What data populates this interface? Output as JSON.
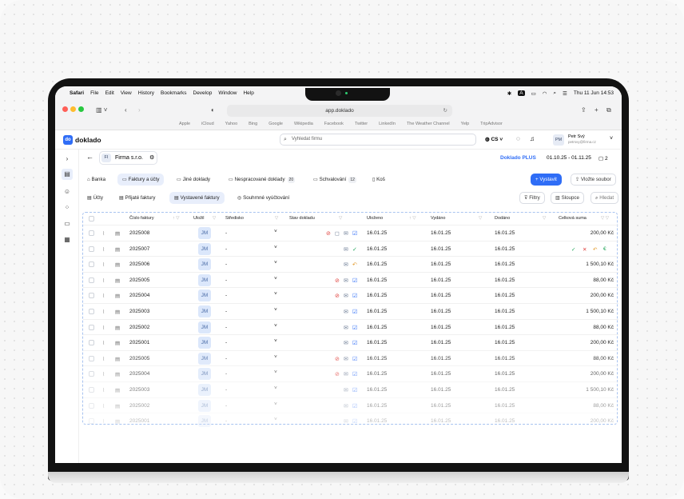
{
  "menubar": {
    "apple": "",
    "app": "Safari",
    "items": [
      "File",
      "Edit",
      "View",
      "History",
      "Bookmarks",
      "Develop",
      "Window",
      "Help"
    ],
    "lang_icon": "A",
    "datetime": "Thu 11 Jun 14:53"
  },
  "safari": {
    "url": "app.doklado",
    "favorites": [
      "Apple",
      "iCloud",
      "Yahoo",
      "Bing",
      "Google",
      "Wikipedia",
      "Facebook",
      "Twitter",
      "LinkedIn",
      "The Weather Channel",
      "Yelp",
      "TripAdvisor"
    ]
  },
  "app": {
    "logo_mark": "do",
    "logo_text": "doklado",
    "search_placeholder": "Vyhledat firmu",
    "lang": "CS",
    "user_initials": "PM",
    "user_name": "Petr Svý",
    "user_email": "petrsvy@firma.cz"
  },
  "company": {
    "initials": "FI",
    "name": "Firma s.r.o."
  },
  "plan": {
    "name": "Doklado PLUS",
    "period": "01.10.25 - 01.11.25",
    "docs": "2"
  },
  "tabs": [
    {
      "label": "Banka"
    },
    {
      "label": "Faktury a účty"
    },
    {
      "label": "Jiné doklady"
    },
    {
      "label": "Nespracované doklady",
      "badge": "20"
    },
    {
      "label": "Schvalování",
      "badge": "12"
    },
    {
      "label": "Koš"
    }
  ],
  "actions": {
    "issue": "Vystavit",
    "upload": "Vložte soubor",
    "filters": "Filtry",
    "columns": "Sloupce",
    "search_placeholder": "Hledat"
  },
  "subtabs": [
    {
      "label": "Účty"
    },
    {
      "label": "Přijaté faktury"
    },
    {
      "label": "Vystavené faktury"
    },
    {
      "label": "Souhrnné vyúčtování"
    }
  ],
  "columns": {
    "number": "Číslo faktury",
    "saved_by": "Uložil",
    "center": "Středisko",
    "status": "Stav dokladu",
    "saved": "Uloženo",
    "issued": "Vydáno",
    "delivered": "Dodáno",
    "total": "Celková suma"
  },
  "rows": [
    {
      "number": "2025008",
      "user": "JM",
      "center": "-",
      "saved": "16.01.25",
      "issued": "16.01.25",
      "delivered": "16.01.25",
      "total": "200,00 Kč",
      "status": [
        "warn",
        "msg",
        "mail",
        "check"
      ]
    },
    {
      "number": "2025007",
      "user": "JM",
      "center": "-",
      "saved": "16.01.25",
      "issued": "16.01.25",
      "delivered": "16.01.25",
      "total": "",
      "status": [
        "mail",
        "ok"
      ]
    },
    {
      "number": "2025006",
      "user": "JM",
      "center": "-",
      "saved": "16.01.25",
      "issued": "16.01.25",
      "delivered": "16.01.25",
      "total": "1 500,10 Kč",
      "status": [
        "mail",
        "back"
      ]
    },
    {
      "number": "2025005",
      "user": "JM",
      "center": "-",
      "saved": "16.01.25",
      "issued": "16.01.25",
      "delivered": "16.01.25",
      "total": "88,00 Kč",
      "status": [
        "warn",
        "mail",
        "check"
      ]
    },
    {
      "number": "2025004",
      "user": "JM",
      "center": "-",
      "saved": "16.01.25",
      "issued": "16.01.25",
      "delivered": "16.01.25",
      "total": "200,00 Kč",
      "status": [
        "warn",
        "mail",
        "check"
      ]
    },
    {
      "number": "2025003",
      "user": "JM",
      "center": "-",
      "saved": "16.01.25",
      "issued": "16.01.25",
      "delivered": "16.01.25",
      "total": "1 500,10 Kč",
      "status": [
        "mail",
        "check"
      ]
    },
    {
      "number": "2025002",
      "user": "JM",
      "center": "-",
      "saved": "16.01.25",
      "issued": "16.01.25",
      "delivered": "16.01.25",
      "total": "88,00 Kč",
      "status": [
        "mail",
        "check"
      ]
    },
    {
      "number": "2025001",
      "user": "JM",
      "center": "-",
      "saved": "16.01.25",
      "issued": "16.01.25",
      "delivered": "16.01.25",
      "total": "200,00 Kč",
      "status": [
        "mail",
        "check"
      ]
    },
    {
      "number": "2025005",
      "user": "JM",
      "center": "-",
      "saved": "16.01.25",
      "issued": "16.01.25",
      "delivered": "16.01.25",
      "total": "88,00 Kč",
      "status": [
        "warn",
        "mail",
        "check"
      ]
    },
    {
      "number": "2025004",
      "user": "JM",
      "center": "-",
      "saved": "16.01.25",
      "issued": "16.01.25",
      "delivered": "16.01.25",
      "total": "200,00 Kč",
      "status": [
        "warn",
        "mail",
        "check"
      ]
    },
    {
      "number": "2025003",
      "user": "JM",
      "center": "-",
      "saved": "16.01.25",
      "issued": "16.01.25",
      "delivered": "16.01.25",
      "total": "1 500,10 Kč",
      "status": [
        "mail",
        "check"
      ]
    },
    {
      "number": "2025002",
      "user": "JM",
      "center": "-",
      "saved": "16.01.25",
      "issued": "16.01.25",
      "delivered": "16.01.25",
      "total": "88,00 Kč",
      "status": [
        "mail",
        "check"
      ]
    },
    {
      "number": "2025001",
      "user": "JM",
      "center": "-",
      "saved": "16.01.25",
      "issued": "16.01.25",
      "delivered": "16.01.25",
      "total": "200,00 Kč",
      "status": [
        "mail",
        "check"
      ]
    }
  ],
  "row_actions": {
    "approve": "✓",
    "reject": "✕",
    "undo": "↶",
    "currency": "€"
  },
  "colors": {
    "accent": "#2f6df6",
    "approve": "#22a55a",
    "reject": "#e0413d",
    "undo": "#e39a2b",
    "currency": "#22a55a"
  }
}
